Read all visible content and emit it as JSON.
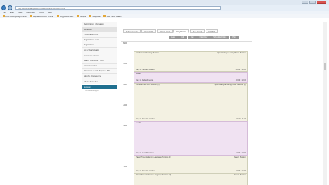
{
  "browser": {
    "address": "http://www.example.com/reservations/schedule.html",
    "menu": [
      "File",
      "Edit",
      "View",
      "Favorites",
      "Tools",
      "Help"
    ],
    "favorites": [
      "UCF Activity Registration",
      "Register Account Online",
      "Suggested Sites",
      "Google",
      "Wikipedia",
      "Web Slice Gallery"
    ]
  },
  "sidebar": {
    "items": [
      "Registration Information",
      "Schedule",
      "Presentation Info",
      "Registration Form",
      "Registration",
      "List of Participants",
      "Computer Access",
      "Health Insurance / TCM",
      "Accommodation",
      "Directions to and Maps to UCF",
      "Sing the Conference",
      "Shuttle Schedule"
    ],
    "support_title": "Support",
    "support_link": "Schedule Support"
  },
  "tabs": [
    "Public Events",
    "Press Edit",
    "Show Listed",
    "Day Shown",
    "Tue Ready",
    "Full Tab"
  ],
  "toolbar": [
    "Less",
    "Edit",
    "Day",
    "Next Day",
    "Schedule Online",
    "Print"
  ],
  "schedule": {
    "times": [
      "09:00",
      "10:00",
      "11:00",
      "12:00",
      "13:00",
      "14:00"
    ],
    "blocks": [
      {
        "title": "Conference Opening Session",
        "right": "Open Dialogue during Panel Session",
        "mid": "",
        "foot_left": "Day 1 - Session location",
        "foot_right": "09:00 - 10:00"
      },
      {
        "title": "Break",
        "right": "",
        "mid": "",
        "foot_left": "Day 1 - Refreshments",
        "foot_right": "10:00 - 10:30"
      },
      {
        "title": "Conference Panel Session (2)",
        "right": "Open Dialogue during Panel Session (2)",
        "mid": "",
        "foot_left": "Day 1 - Session location",
        "foot_right": "10:30 - 11:30"
      },
      {
        "title": "Lunch",
        "right": "",
        "mid": "",
        "foot_left": "Day 1 - Lunch location",
        "foot_right": "12:00 - 13:00"
      },
      {
        "title": "Panel Presentation on Language Policies (1)",
        "right": "Panel - Session",
        "mid": "",
        "foot_left": "Day 1 - Session location",
        "foot_right": "13:00 - 14:00"
      },
      {
        "title": "Panel Presentation on Language Policies (2)",
        "right": "Panel - Session",
        "mid": "",
        "foot_left": "",
        "foot_right": ""
      }
    ]
  }
}
